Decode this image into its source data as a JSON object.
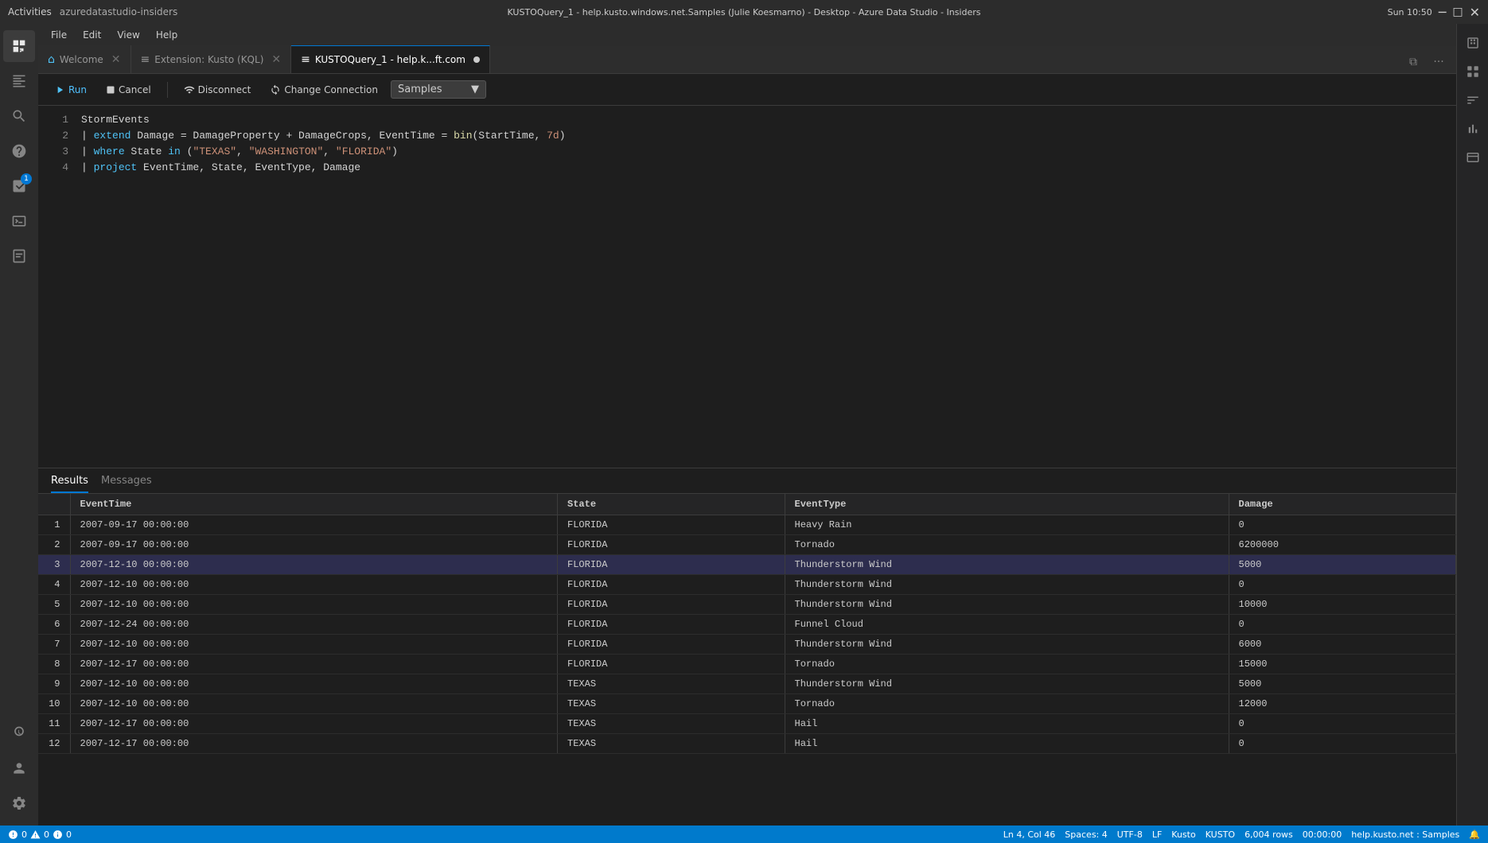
{
  "titleBar": {
    "title": "KUSTOQuery_1 - help.kusto.windows.net.Samples (Julie Koesmarno) - Desktop - Azure Data Studio - Insiders",
    "time": "Sun 10:50",
    "activities": "Activities",
    "appName": "azuredatastudio-insiders"
  },
  "menuBar": {
    "items": [
      "File",
      "Edit",
      "View",
      "Help"
    ]
  },
  "tabs": [
    {
      "label": "Welcome",
      "icon": "🏠",
      "active": false
    },
    {
      "label": "Extension: Kusto (KQL)",
      "icon": "≡",
      "active": false
    },
    {
      "label": "KUSTOQuery_1 - help.k...ft.com",
      "icon": "≡",
      "active": true,
      "modified": true
    }
  ],
  "toolbar": {
    "runLabel": "Run",
    "cancelLabel": "Cancel",
    "disconnectLabel": "Disconnect",
    "changeConnectionLabel": "Change Connection",
    "database": "Samples"
  },
  "editor": {
    "lines": [
      {
        "num": 1,
        "content": "StormEvents",
        "tokens": [
          {
            "text": "StormEvents",
            "class": "kw-white"
          }
        ]
      },
      {
        "num": 2,
        "content": "| extend Damage = DamageProperty + DamageCrops, EventTime = bin(StartTime, 7d)",
        "tokens": [
          {
            "text": "| ",
            "class": "kw-pipe"
          },
          {
            "text": "extend",
            "class": "kw-blue"
          },
          {
            "text": " Damage = DamageProperty + DamageCrops, EventTime = ",
            "class": "kw-white"
          },
          {
            "text": "bin",
            "class": "kw-yellow"
          },
          {
            "text": "(StartTime, ",
            "class": "kw-white"
          },
          {
            "text": "7d",
            "class": "kw-orange"
          },
          {
            "text": ")",
            "class": "kw-white"
          }
        ]
      },
      {
        "num": 3,
        "content": "| where State in (\"TEXAS\", \"WASHINGTON\", \"FLORIDA\")",
        "tokens": [
          {
            "text": "| ",
            "class": "kw-pipe"
          },
          {
            "text": "where",
            "class": "kw-blue"
          },
          {
            "text": " State ",
            "class": "kw-white"
          },
          {
            "text": "in",
            "class": "kw-blue"
          },
          {
            "text": " (",
            "class": "kw-white"
          },
          {
            "text": "\"TEXAS\"",
            "class": "kw-orange"
          },
          {
            "text": ", ",
            "class": "kw-white"
          },
          {
            "text": "\"WASHINGTON\"",
            "class": "kw-orange"
          },
          {
            "text": ", ",
            "class": "kw-white"
          },
          {
            "text": "\"FLORIDA\"",
            "class": "kw-orange"
          },
          {
            "text": ")",
            "class": "kw-white"
          }
        ]
      },
      {
        "num": 4,
        "content": "| project EventTime, State, EventType, Damage",
        "tokens": [
          {
            "text": "| ",
            "class": "kw-pipe"
          },
          {
            "text": "project",
            "class": "kw-blue"
          },
          {
            "text": " EventTime, State, EventType, Damage",
            "class": "kw-white"
          }
        ]
      }
    ]
  },
  "results": {
    "tabs": [
      "Results",
      "Messages"
    ],
    "activeTab": "Results",
    "columns": [
      "EventTime",
      "State",
      "EventType",
      "Damage"
    ],
    "rows": [
      {
        "num": 1,
        "eventTime": "2007-09-17 00:00:00",
        "state": "FLORIDA",
        "eventType": "Heavy Rain",
        "damage": "0"
      },
      {
        "num": 2,
        "eventTime": "2007-09-17 00:00:00",
        "state": "FLORIDA",
        "eventType": "Tornado",
        "damage": "6200000"
      },
      {
        "num": 3,
        "eventTime": "2007-12-10 00:00:00",
        "state": "FLORIDA",
        "eventType": "Thunderstorm Wind",
        "damage": "5000",
        "highlighted": true
      },
      {
        "num": 4,
        "eventTime": "2007-12-10 00:00:00",
        "state": "FLORIDA",
        "eventType": "Thunderstorm Wind",
        "damage": "0"
      },
      {
        "num": 5,
        "eventTime": "2007-12-10 00:00:00",
        "state": "FLORIDA",
        "eventType": "Thunderstorm Wind",
        "damage": "10000"
      },
      {
        "num": 6,
        "eventTime": "2007-12-24 00:00:00",
        "state": "FLORIDA",
        "eventType": "Funnel Cloud",
        "damage": "0"
      },
      {
        "num": 7,
        "eventTime": "2007-12-10 00:00:00",
        "state": "FLORIDA",
        "eventType": "Thunderstorm Wind",
        "damage": "6000"
      },
      {
        "num": 8,
        "eventTime": "2007-12-17 00:00:00",
        "state": "FLORIDA",
        "eventType": "Tornado",
        "damage": "15000"
      },
      {
        "num": 9,
        "eventTime": "2007-12-10 00:00:00",
        "state": "TEXAS",
        "eventType": "Thunderstorm Wind",
        "damage": "5000"
      },
      {
        "num": 10,
        "eventTime": "2007-12-10 00:00:00",
        "state": "TEXAS",
        "eventType": "Tornado",
        "damage": "12000"
      },
      {
        "num": 11,
        "eventTime": "2007-12-17 00:00:00",
        "state": "TEXAS",
        "eventType": "Hail",
        "damage": "0"
      },
      {
        "num": 12,
        "eventTime": "2007-12-17 00:00:00",
        "state": "TEXAS",
        "eventType": "Hail",
        "damage": "0"
      }
    ]
  },
  "statusBar": {
    "errors": "0",
    "warnings": "0",
    "infos": "0",
    "line": "Ln 4, Col 46",
    "spaces": "Spaces: 4",
    "encoding": "UTF-8",
    "lineEnding": "LF",
    "language": "Kusto",
    "schema": "KUSTO",
    "rows": "6,004 rows",
    "time": "00:00:00",
    "server": "help.kusto.net : Samples"
  },
  "activityBar": {
    "icons": [
      {
        "name": "extensions-icon",
        "glyph": "⊞",
        "label": "Extensions"
      },
      {
        "name": "explorer-icon",
        "glyph": "📋",
        "label": "Explorer"
      },
      {
        "name": "search-icon",
        "glyph": "🔍",
        "label": "Search"
      },
      {
        "name": "help-icon",
        "glyph": "?",
        "label": "Help"
      },
      {
        "name": "connections-icon",
        "glyph": "⚡",
        "label": "Connections",
        "badge": "1"
      },
      {
        "name": "terminal-icon",
        "glyph": ">_",
        "label": "Terminal"
      },
      {
        "name": "extensions2-icon",
        "glyph": "🧩",
        "label": "Extensions 2"
      }
    ],
    "bottomIcons": [
      {
        "name": "git-icon",
        "glyph": "⑂",
        "label": "Source Control"
      },
      {
        "name": "account-icon",
        "glyph": "👤",
        "label": "Account"
      },
      {
        "name": "settings-icon",
        "glyph": "⚙",
        "label": "Settings"
      }
    ]
  }
}
